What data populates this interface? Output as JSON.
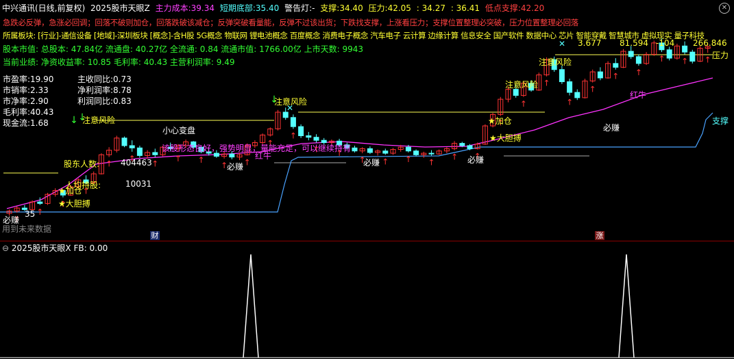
{
  "header": {
    "stock": "中兴通讯(日线,前复权)",
    "indicator": "2025股市天眼Z",
    "main_cost_label": "主力成本:",
    "main_cost": "39.34",
    "short_bottom_label": "短期底部:",
    "short_bottom": "35.40",
    "warning_label": "警告灯:",
    "warning_value": "-",
    "support_label": "支撑:",
    "support": "34.40",
    "pressure_label": "压力:",
    "pressure": "42.05",
    "extra1": ": 34.27",
    "extra2": ": 36.41",
    "low_support_label": "低点支撑:",
    "low_support": "42.20"
  },
  "advice_line": "急跌必反弹，急涨必回调；回落不破则加仓，回落跌破该减仓；反弹突破看量能，反弹不过该出货；下跌找支撑，上涨看压力；支撑位置整理必突破，压力位置整理必回落",
  "sector_line": "所属板块: [行业]-通信设备 [地域]-深圳板块 [概念]-含H股 5G概念 物联网 锂电池概念 百度概念 消费电子概念 汽车电子 云计算 边缘计算 信息安全 国产软件 数据中心 芯片 智能穿戴 智慧城市 虚拟现实 量子科技",
  "market_line": "股本市值: 总股本: 47.84亿 流通盘: 40.27亿 全流通: 0.84 流通市值: 1766.00亿 上市天数: 9943",
  "perf_line": "当前业绩: 净资收益率: 10.85 毛利率: 40.43 主营利润率: 9.49",
  "left_stats": [
    {
      "label": "市盈率:",
      "value": "19.90"
    },
    {
      "label": "市销率:",
      "value": "2.33"
    },
    {
      "label": "市净率:",
      "value": "2.90"
    },
    {
      "label": "毛利率:",
      "value": "40.43"
    },
    {
      "label": "现金流:",
      "value": "1.68"
    }
  ],
  "right_stats": [
    {
      "label": "主收同比:",
      "value": "0.73"
    },
    {
      "label": "净利润率:",
      "value": "8.78"
    },
    {
      "label": "利润同比:",
      "value": "0.83"
    }
  ],
  "annotations": {
    "caution1": "注意风险",
    "caution2": "注意风险",
    "caution3": "注意风险",
    "caution4": "注意风险",
    "careful": "小心变盘",
    "holders": "股东人数:",
    "holders_value": "404463",
    "per_capita": "人均持股:",
    "per_capita_value": "10031",
    "buy1": "★加仓",
    "buy2": "★大胆搏",
    "buy3": "★加仓",
    "buy4": "★大胆搏",
    "earn1": "必赚",
    "earn2": "必赚",
    "earn3": "必赚",
    "earn4": "必赚",
    "earn5": "必赚",
    "red_cow1": "红牛",
    "red_cow2": "红牛",
    "trend_text": "该股形态良好，强势明显，量能充足，可以继续持有",
    "pressure_tag": "压力",
    "support_tag": "支撑",
    "top_vals": "3.677",
    "top_vals2": "81.594",
    "top_vals3": "-104",
    "top_vals4": "266.846",
    "future_data": "用到未来数据",
    "low_left": "35",
    "cai": "财",
    "zhang": "涨"
  },
  "sub_panel": {
    "title": "2025股市天眼X",
    "fb_label": "FB:",
    "fb_value": "0.00"
  },
  "colors": {
    "up": "#ff3333",
    "down": "#54ffff",
    "ma": "#ff33ff",
    "support_line": "#4aa3ff",
    "level_line": "#ffff55",
    "text_red": "#ff4040",
    "text_yellow": "#ffff33",
    "text_green": "#33ff33",
    "text_magenta": "#ff40ff"
  },
  "candles": [
    [
      30.9,
      31.4,
      30.6,
      31.2
    ],
    [
      31.2,
      31.8,
      31.0,
      31.6
    ],
    [
      31.6,
      32.0,
      31.2,
      31.4
    ],
    [
      31.4,
      32.6,
      31.3,
      32.4
    ],
    [
      32.4,
      33.0,
      32.0,
      32.2
    ],
    [
      32.2,
      33.6,
      32.0,
      33.4
    ],
    [
      33.4,
      34.2,
      33.1,
      33.9
    ],
    [
      33.9,
      34.0,
      33.0,
      33.3
    ],
    [
      33.3,
      34.6,
      33.2,
      34.4
    ],
    [
      34.4,
      35.5,
      34.1,
      35.3
    ],
    [
      35.3,
      35.9,
      34.7,
      34.9
    ],
    [
      34.9,
      36.4,
      34.8,
      36.1
    ],
    [
      36.1,
      38.8,
      36.0,
      38.6
    ],
    [
      38.6,
      39.6,
      38.3,
      39.2
    ],
    [
      39.2,
      41.1,
      38.9,
      40.8
    ],
    [
      40.8,
      41.0,
      39.6,
      39.8
    ],
    [
      39.8,
      40.5,
      39.0,
      39.5
    ],
    [
      39.5,
      39.8,
      38.2,
      38.5
    ],
    [
      38.5,
      39.2,
      38.1,
      38.9
    ],
    [
      38.9,
      39.4,
      38.3,
      38.6
    ],
    [
      38.6,
      39.8,
      38.4,
      39.6
    ],
    [
      39.6,
      40.2,
      39.1,
      39.4
    ],
    [
      39.4,
      40.0,
      39.0,
      39.8
    ],
    [
      39.8,
      40.6,
      39.5,
      40.3
    ],
    [
      40.3,
      40.4,
      39.4,
      39.6
    ],
    [
      39.6,
      39.7,
      38.8,
      39.0
    ],
    [
      39.0,
      39.4,
      38.5,
      38.8
    ],
    [
      38.8,
      39.2,
      38.2,
      38.4
    ],
    [
      38.4,
      39.0,
      38.1,
      38.7
    ],
    [
      38.7,
      39.1,
      38.0,
      38.3
    ],
    [
      38.3,
      38.9,
      37.9,
      38.6
    ],
    [
      38.6,
      40.1,
      38.5,
      39.8
    ],
    [
      39.8,
      40.5,
      39.5,
      40.2
    ],
    [
      40.2,
      41.4,
      40.0,
      41.2
    ],
    [
      41.2,
      42.2,
      41.0,
      42.0
    ],
    [
      42.0,
      44.5,
      41.8,
      44.2
    ],
    [
      44.2,
      44.8,
      43.2,
      43.5
    ],
    [
      43.5,
      43.9,
      42.0,
      42.3
    ],
    [
      42.3,
      42.6,
      40.8,
      41.1
    ],
    [
      41.1,
      41.6,
      40.5,
      40.9
    ],
    [
      40.9,
      41.3,
      40.2,
      40.5
    ],
    [
      40.5,
      40.8,
      39.9,
      40.2
    ],
    [
      40.2,
      40.6,
      39.8,
      40.4
    ],
    [
      40.4,
      40.7,
      39.7,
      39.9
    ],
    [
      39.9,
      40.2,
      39.3,
      39.5
    ],
    [
      39.5,
      39.8,
      38.9,
      39.1
    ],
    [
      39.1,
      39.6,
      38.8,
      39.4
    ],
    [
      39.4,
      39.7,
      38.7,
      38.9
    ],
    [
      38.9,
      39.3,
      38.5,
      39.1
    ],
    [
      39.1,
      39.4,
      38.6,
      38.8
    ],
    [
      38.8,
      39.5,
      38.6,
      39.3
    ],
    [
      39.3,
      39.9,
      39.0,
      39.6
    ],
    [
      39.6,
      39.9,
      38.9,
      39.1
    ],
    [
      39.1,
      39.3,
      38.4,
      38.6
    ],
    [
      38.6,
      39.0,
      38.2,
      38.8
    ],
    [
      38.8,
      39.2,
      38.5,
      38.7
    ],
    [
      38.7,
      39.3,
      38.6,
      39.1
    ],
    [
      39.1,
      39.6,
      38.8,
      39.4
    ],
    [
      39.4,
      40.4,
      39.2,
      40.1
    ],
    [
      40.1,
      40.3,
      39.6,
      39.8
    ],
    [
      39.8,
      40.0,
      39.2,
      39.4
    ],
    [
      39.4,
      40.2,
      39.3,
      40.0
    ],
    [
      40.0,
      42.6,
      39.9,
      42.4
    ],
    [
      42.4,
      44.1,
      42.2,
      43.9
    ],
    [
      43.9,
      46.2,
      43.7,
      45.9
    ],
    [
      45.9,
      47.6,
      45.5,
      47.2
    ],
    [
      47.2,
      47.8,
      46.1,
      46.4
    ],
    [
      46.4,
      48.3,
      46.2,
      48.0
    ],
    [
      48.0,
      48.4,
      46.9,
      47.1
    ],
    [
      47.1,
      49.4,
      47.0,
      49.1
    ],
    [
      49.1,
      51.4,
      48.9,
      51.1
    ],
    [
      51.1,
      51.5,
      49.5,
      49.8
    ],
    [
      49.8,
      50.3,
      47.9,
      48.2
    ],
    [
      48.2,
      48.6,
      46.4,
      46.8
    ],
    [
      46.8,
      47.2,
      45.8,
      46.1
    ],
    [
      46.1,
      48.6,
      46.0,
      48.3
    ],
    [
      48.3,
      49.8,
      48.1,
      49.5
    ],
    [
      49.5,
      50.1,
      48.4,
      48.7
    ],
    [
      48.7,
      50.9,
      48.6,
      50.6
    ],
    [
      50.6,
      51.3,
      49.8,
      50.1
    ],
    [
      50.1,
      52.5,
      50.0,
      52.2
    ],
    [
      52.2,
      52.9,
      51.2,
      51.5
    ],
    [
      51.5,
      51.8,
      50.3,
      50.6
    ],
    [
      50.6,
      52.1,
      50.4,
      51.8
    ],
    [
      51.8,
      53.6,
      51.6,
      53.3
    ],
    [
      53.3,
      53.9,
      52.1,
      52.4
    ],
    [
      52.4,
      52.8,
      51.0,
      51.3
    ],
    [
      51.3,
      53.2,
      51.1,
      52.9
    ],
    [
      52.9,
      53.5,
      51.8,
      52.1
    ],
    [
      52.1,
      52.4,
      50.6,
      50.9
    ],
    [
      50.9,
      52.9,
      50.8,
      52.6
    ],
    [
      52.6,
      53.1,
      52.0,
      52.8
    ]
  ]
}
